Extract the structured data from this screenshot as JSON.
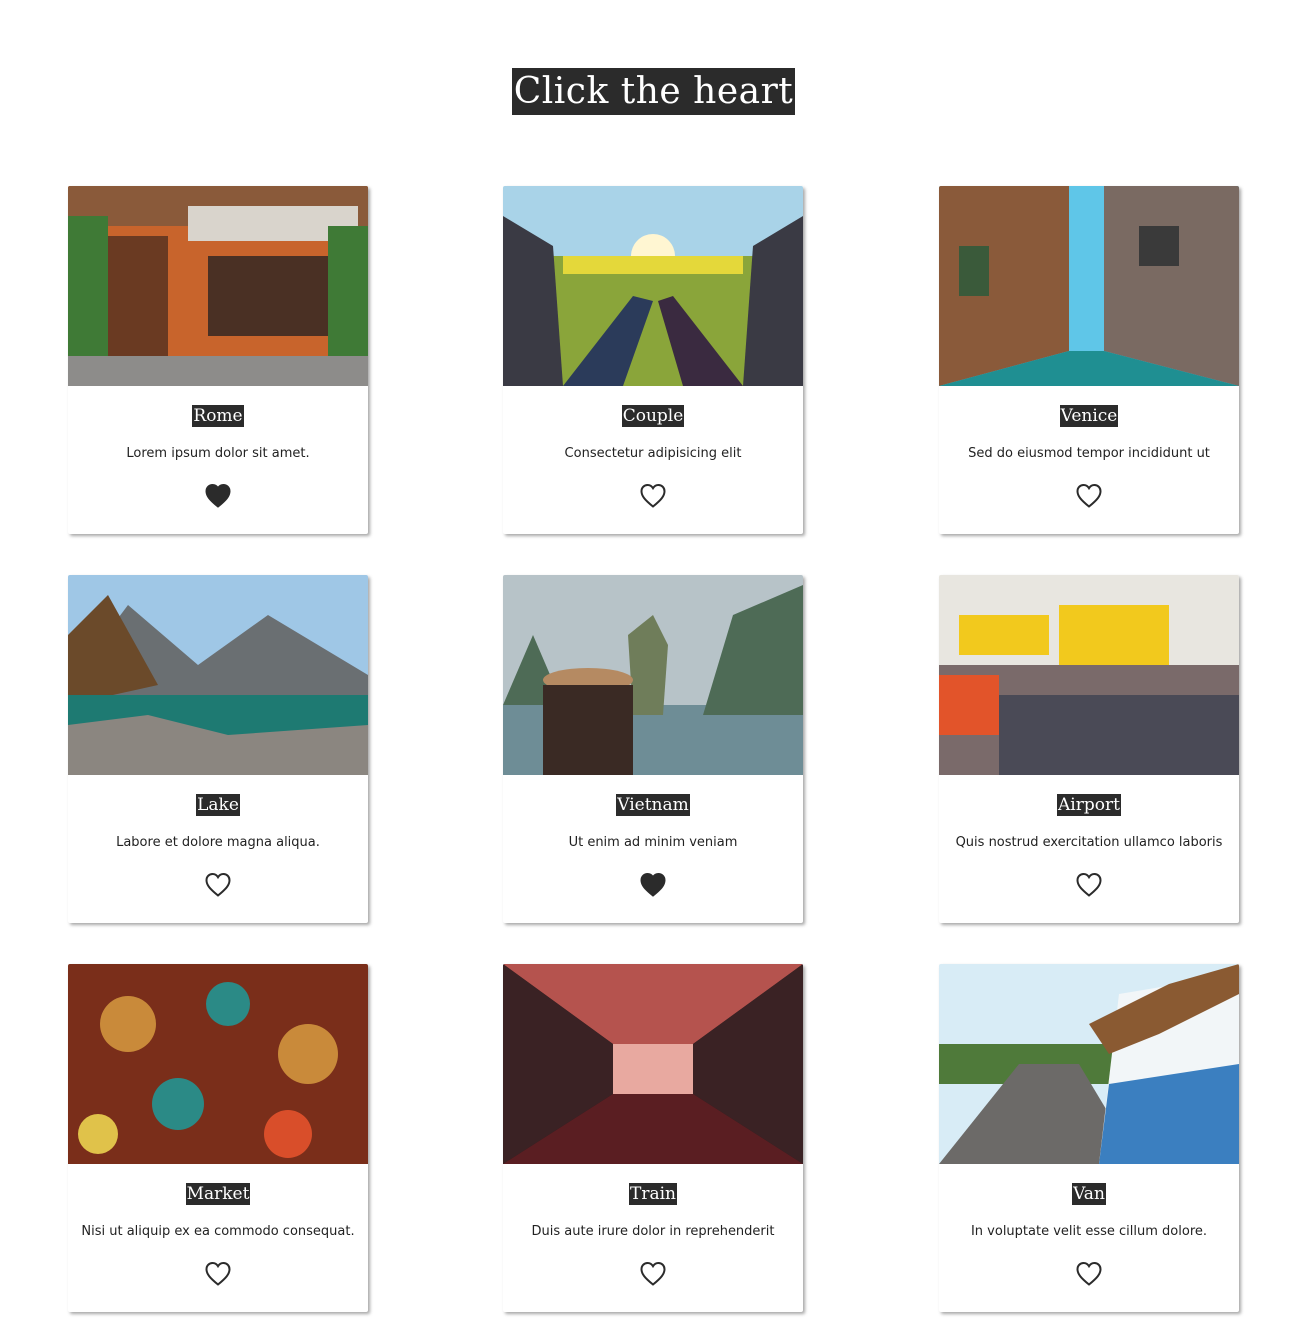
{
  "page": {
    "title": "Click the heart"
  },
  "colors": {
    "accent_dark": "#2b2b2b",
    "heart": "#2b2b2b",
    "background": "#ffffff"
  },
  "cards": [
    {
      "title": "Rome",
      "text": "Lorem ipsum dolor sit amet.",
      "liked": true,
      "image": "rome-bar-photo",
      "palette": [
        "#c8642c",
        "#3f7a36",
        "#d9d4cc"
      ]
    },
    {
      "title": "Couple",
      "text": "Consectetur adipisicing elit",
      "liked": false,
      "image": "couple-car-field-photo",
      "palette": [
        "#a9d3e8",
        "#8aa53a",
        "#2b3b5a"
      ]
    },
    {
      "title": "Venice",
      "text": "Sed do eiusmod tempor incididunt ut",
      "liked": false,
      "image": "venice-canal-photo",
      "palette": [
        "#5fc6e8",
        "#8a5a3a",
        "#1f8f92"
      ]
    },
    {
      "title": "Lake",
      "text": "Labore et dolore magna aliqua.",
      "liked": false,
      "image": "mountain-lake-photo",
      "palette": [
        "#9fc7e6",
        "#6a6f72",
        "#1e7a72"
      ]
    },
    {
      "title": "Vietnam",
      "text": "Ut enim ad minim veniam",
      "liked": true,
      "image": "vietnam-rock-photo",
      "palette": [
        "#b7c3c8",
        "#4e6b56",
        "#6e8d96"
      ]
    },
    {
      "title": "Airport",
      "text": "Quis nostrud exercitation ullamco laboris",
      "liked": false,
      "image": "airport-terminal-photo",
      "palette": [
        "#e8e6e0",
        "#f2c91d",
        "#4a4a56"
      ]
    },
    {
      "title": "Market",
      "text": "Nisi ut aliquip ex ea commodo consequat.",
      "liked": false,
      "image": "market-lanterns-photo",
      "palette": [
        "#7a2e1a",
        "#c98a3a",
        "#2b8a86"
      ]
    },
    {
      "title": "Train",
      "text": "Duis aute irure dolor in reprehenderit",
      "liked": false,
      "image": "train-interior-photo",
      "palette": [
        "#2a1a1c",
        "#b5534e",
        "#e8a9a0"
      ]
    },
    {
      "title": "Van",
      "text": "In voluptate velit esse cillum dolore.",
      "liked": false,
      "image": "van-road-photo",
      "palette": [
        "#d8ecf6",
        "#3b7fc0",
        "#6c6a68"
      ]
    }
  ]
}
